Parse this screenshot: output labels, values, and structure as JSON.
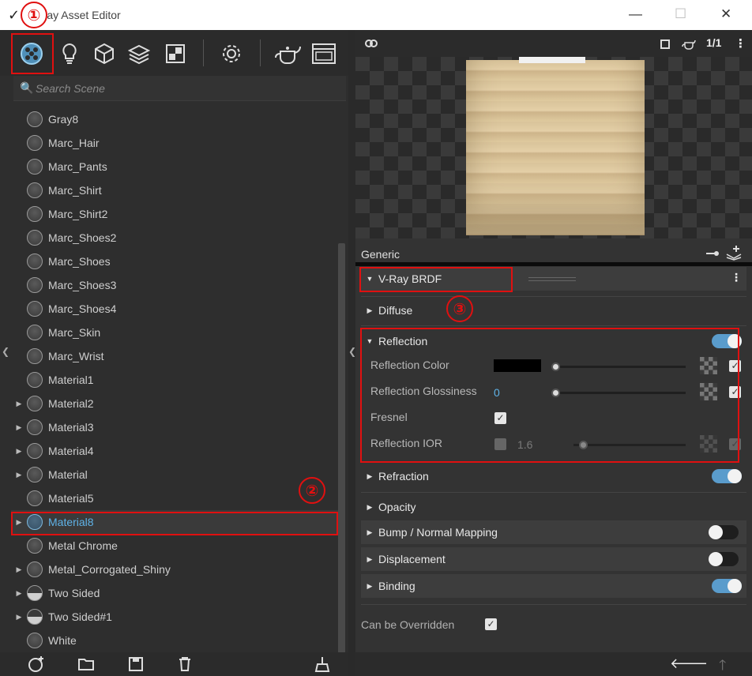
{
  "window": {
    "title": "V-Ray Asset Editor",
    "controls": [
      "minimize-icon",
      "maximize-icon",
      "close-icon"
    ]
  },
  "annotations": [
    "①",
    "②",
    "③"
  ],
  "toolbar": {
    "buttons": [
      "materials-icon",
      "lights-icon",
      "geometry-icon",
      "layers-icon",
      "render-elements-icon",
      "settings-icon",
      "render-teapot-icon",
      "frame-buffer-icon"
    ]
  },
  "search": {
    "placeholder": "Search Scene",
    "value": ""
  },
  "materials": [
    {
      "name": "Gray8",
      "expandable": false,
      "ball": "solid"
    },
    {
      "name": "Marc_Hair",
      "expandable": false,
      "ball": "solid"
    },
    {
      "name": "Marc_Pants",
      "expandable": false,
      "ball": "solid"
    },
    {
      "name": "Marc_Shirt",
      "expandable": false,
      "ball": "solid"
    },
    {
      "name": "Marc_Shirt2",
      "expandable": false,
      "ball": "solid"
    },
    {
      "name": "Marc_Shoes2",
      "expandable": false,
      "ball": "solid"
    },
    {
      "name": "Marc_Shoes",
      "expandable": false,
      "ball": "solid"
    },
    {
      "name": "Marc_Shoes3",
      "expandable": false,
      "ball": "solid"
    },
    {
      "name": "Marc_Shoes4",
      "expandable": false,
      "ball": "solid"
    },
    {
      "name": "Marc_Skin",
      "expandable": false,
      "ball": "solid"
    },
    {
      "name": "Marc_Wrist",
      "expandable": false,
      "ball": "solid"
    },
    {
      "name": "Material1",
      "expandable": false,
      "ball": "solid"
    },
    {
      "name": "Material2",
      "expandable": true,
      "ball": "solid"
    },
    {
      "name": "Material3",
      "expandable": true,
      "ball": "solid"
    },
    {
      "name": "Material4",
      "expandable": true,
      "ball": "solid"
    },
    {
      "name": "Material",
      "expandable": true,
      "ball": "solid"
    },
    {
      "name": "Material5",
      "expandable": false,
      "ball": "solid"
    },
    {
      "name": "Material8",
      "expandable": true,
      "ball": "solid",
      "selected": true
    },
    {
      "name": "Metal Chrome",
      "expandable": false,
      "ball": "solid"
    },
    {
      "name": "Metal_Corrogated_Shiny",
      "expandable": true,
      "ball": "solid"
    },
    {
      "name": "Two Sided",
      "expandable": true,
      "ball": "half"
    },
    {
      "name": "Two Sided#1",
      "expandable": true,
      "ball": "half"
    },
    {
      "name": "White",
      "expandable": false,
      "ball": "solid"
    }
  ],
  "bottom_left": [
    "add-material-icon",
    "open-folder-icon",
    "save-icon",
    "delete-icon",
    "purge-icon"
  ],
  "preview_bar": {
    "ratio_label": "1/1"
  },
  "properties": {
    "generic_label": "Generic",
    "brdf_label": "V-Ray BRDF",
    "sections": {
      "diffuse": "Diffuse",
      "reflection": "Reflection",
      "refraction": "Refraction",
      "opacity": "Opacity",
      "bump": "Bump / Normal Mapping",
      "displacement": "Displacement",
      "binding": "Binding"
    },
    "reflection": {
      "color_label": "Reflection Color",
      "color_value": "#000000",
      "glossiness_label": "Reflection Glossiness",
      "glossiness_value": "0",
      "fresnel_label": "Fresnel",
      "ior_label": "Reflection IOR",
      "ior_value": "1.6"
    },
    "toggles": {
      "reflection": true,
      "refraction": true,
      "bump": false,
      "displacement": false,
      "binding": true
    },
    "override_label": "Can be Overridden"
  },
  "colors": {
    "accent": "#5a9ccc",
    "selected_text": "#5fb3e8",
    "annotation": "#e01010"
  }
}
